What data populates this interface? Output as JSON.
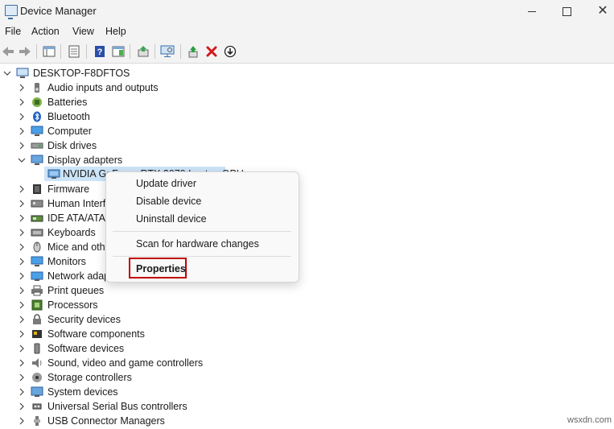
{
  "window": {
    "title": "Device Manager",
    "controls": {
      "minimize": "minimize",
      "maximize": "maximize",
      "close": "✕"
    }
  },
  "menu": [
    "File",
    "Action",
    "View",
    "Help"
  ],
  "toolbar": {
    "buttons": [
      "back-icon",
      "forward-icon",
      "show-hide-tree-icon",
      "properties-icon",
      "help-icon",
      "action-pane-icon",
      "update-driver-icon",
      "scan-hardware-icon",
      "add-legacy-icon",
      "uninstall-icon",
      "disable-icon"
    ]
  },
  "tree": {
    "root": "DESKTOP-F8DFTOS",
    "categories": [
      "Audio inputs and outputs",
      "Batteries",
      "Bluetooth",
      "Computer",
      "Disk drives",
      "Display adapters",
      "Firmware",
      "Human Interf",
      "IDE ATA/ATAP",
      "Keyboards",
      "Mice and oth",
      "Monitors",
      "Network adap",
      "Print queues",
      "Processors",
      "Security devices",
      "Software components",
      "Software devices",
      "Sound, video and game controllers",
      "Storage controllers",
      "System devices",
      "Universal Serial Bus controllers",
      "USB Connector Managers"
    ],
    "selected_device": "NVIDIA GeForce RTX 2070 Laptop GPU"
  },
  "context_menu": {
    "items": [
      "Update driver",
      "Disable device",
      "Uninstall device",
      "Scan for hardware changes",
      "Properties"
    ],
    "highlighted": "Properties",
    "highlight_color": "#c00000"
  },
  "colors": {
    "chrome": "#f3f3f3",
    "selection": "#cce4f7",
    "accent": "#0067c0"
  },
  "watermark": "wsxdn.com"
}
